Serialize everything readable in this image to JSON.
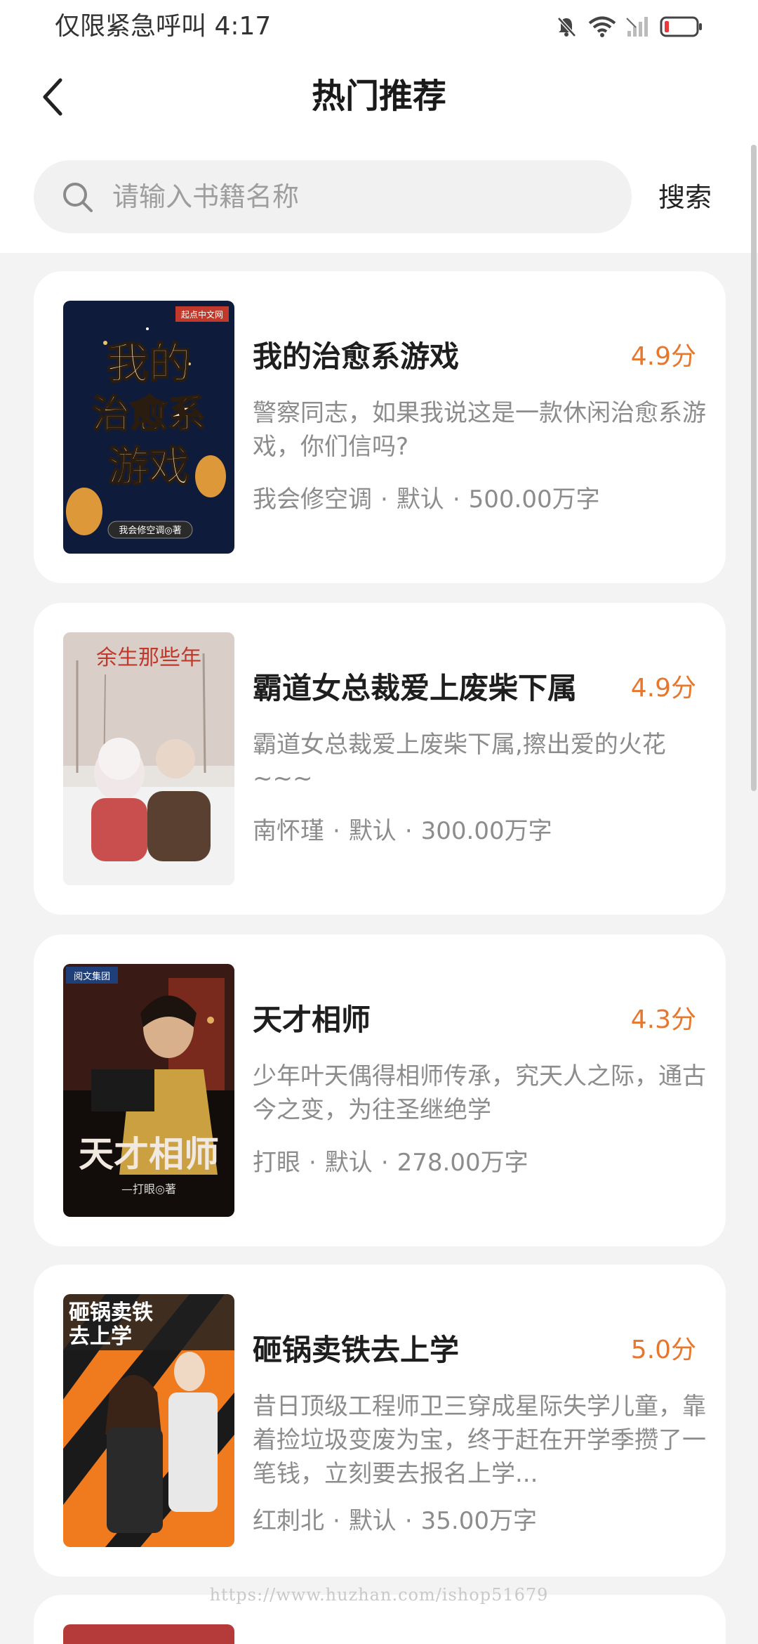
{
  "status_bar": {
    "left_text": "仅限紧急呼叫 4:17",
    "icons": [
      "bell-muted-icon",
      "wifi-icon",
      "signal-icon",
      "battery-low-icon"
    ],
    "battery_color": "#e83a3a"
  },
  "header": {
    "back_icon": "chevron-left-icon",
    "title": "热门推荐"
  },
  "search": {
    "placeholder": "请输入书籍名称",
    "value": "",
    "button_label": "搜索",
    "icon": "search-icon"
  },
  "books": [
    {
      "title": "我的治愈系游戏",
      "rating": "4.9分",
      "description": "警察同志，如果我说这是一款休闲治愈系游戏，你们信吗?",
      "author": "我会修空调",
      "category": "默认",
      "word_count": "500.00万字",
      "cover_text": [
        "我的",
        "治愈系",
        "游戏"
      ],
      "cover_author": "我会修空调◎著",
      "cover_badge": "起点中文网"
    },
    {
      "title": "霸道女总裁爱上废柴下属",
      "rating": "4.9分",
      "description": "霸道女总裁爱上废柴下属,擦出爱的火花~~~",
      "author": "南怀瑾",
      "category": "默认",
      "word_count": "300.00万字",
      "cover_text": [
        "余生那些年"
      ],
      "cover_author": "",
      "cover_badge": ""
    },
    {
      "title": "天才相师",
      "rating": "4.3分",
      "description": "少年叶天偶得相师传承，究天人之际，通古今之变，为往圣继绝学",
      "author": "打眼",
      "category": "默认",
      "word_count": "278.00万字",
      "cover_text": [
        "天才相师"
      ],
      "cover_author": "—打眼◎著",
      "cover_badge": "阅文集团"
    },
    {
      "title": "砸锅卖铁去上学",
      "rating": "5.0分",
      "description": "昔日顶级工程师卫三穿成星际失学儿童，靠着捡垃圾变废为宝，终于赶在开学季攒了一笔钱，立刻要去报名上学...",
      "author": "红刺北",
      "category": "默认",
      "word_count": "35.00万字",
      "cover_text": [
        "砸锅卖铁",
        "去上学"
      ],
      "cover_author": "",
      "cover_badge": ""
    }
  ],
  "meta_separator": "·",
  "watermark": "https://www.huzhan.com/ishop51679",
  "colors": {
    "accent_rating": "#e8772e",
    "page_background": "#f3f3f3",
    "card_background": "#ffffff"
  }
}
